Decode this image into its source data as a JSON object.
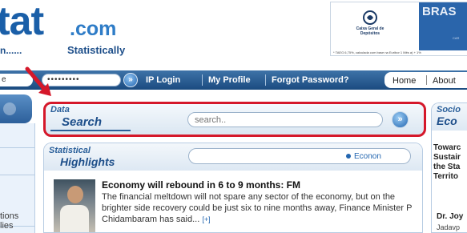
{
  "header": {
    "logo_main": "tat",
    "logo_suffix": ".com",
    "tagline_prefix": "n......",
    "tagline": "Statistically"
  },
  "banner": {
    "brand_line": "Caixa Geral de Depósitos",
    "right_text": "BRAS",
    "right_small": "CAR",
    "fine_print": "* TAEG 6,75%, calculada com base na Euribor 1 Mês a) + 1%"
  },
  "navbar": {
    "left_field_value": "e",
    "password_value": "•••••••••",
    "go_symbol": "»",
    "links": [
      "IP Login",
      "My Profile",
      "Forgot Password?"
    ],
    "right_links": [
      "Home",
      "About"
    ]
  },
  "left_column": {
    "items": [
      "tions",
      "lies"
    ]
  },
  "search": {
    "title_small": "Data",
    "title_large": "Search",
    "placeholder": "search..",
    "go_symbol": "»"
  },
  "highlights": {
    "title_small": "Statistical",
    "title_large": "Highlights",
    "ticker_text": "Econon",
    "headline": "Economy will rebound in 6 to 9 months: FM",
    "body": "The financial meltdown will not spare any sector of the economy, but on the brighter side recovery could be just six to nine months away, Finance Minister P Chidambaram has said...",
    "more": "[+]"
  },
  "right_panel": {
    "title_small": "Socio",
    "title_large": "Eco",
    "lines": [
      "Towarc",
      "Sustair",
      "the Sta",
      "Territo"
    ],
    "author": "Dr. Joy",
    "affiliation": "Jadavp"
  },
  "colors": {
    "brand_blue": "#1a5fa8",
    "nav_blue": "#1b4b80",
    "highlight_red": "#d5182a"
  }
}
